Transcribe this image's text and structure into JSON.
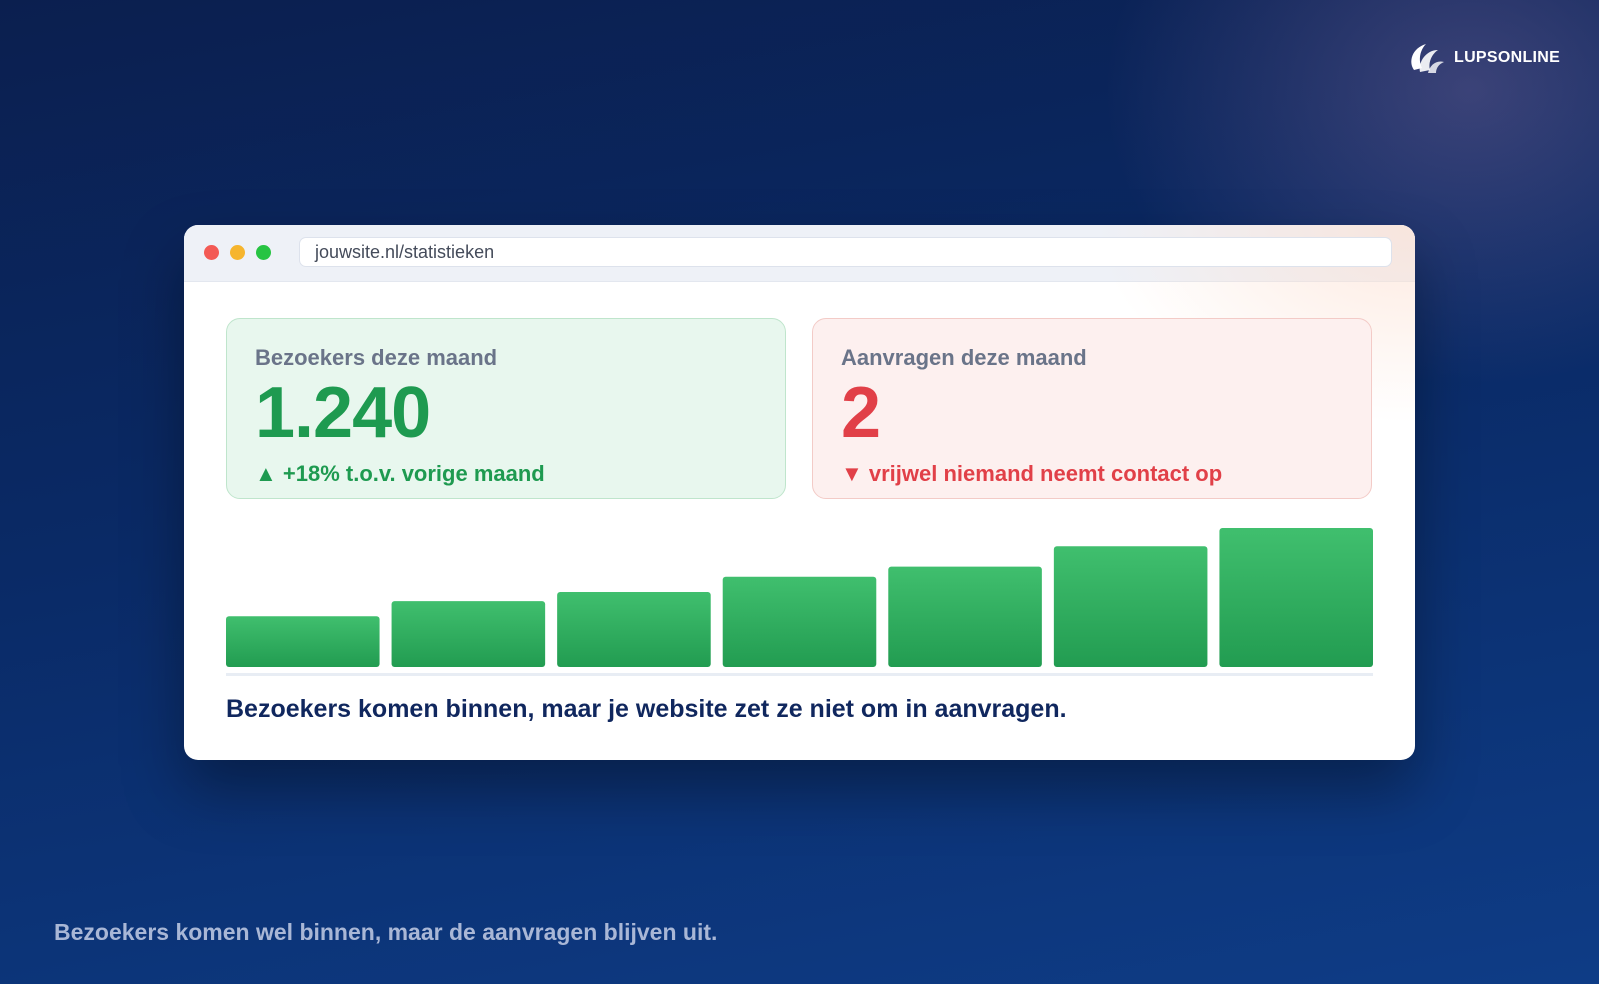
{
  "brand": {
    "logo_text": "LUPSONLINE",
    "logo_icon": "lupsonline-logo-icon"
  },
  "browser": {
    "url": "jouwsite.nl/statistieken",
    "controls": [
      "close-dot",
      "minimize-dot",
      "maximize-dot"
    ]
  },
  "cards": {
    "visitors": {
      "label": "Bezoekers deze maand",
      "value": "1.240",
      "note": "▲ +18% t.o.v. vorige maand",
      "color": "#1e9a50"
    },
    "requests": {
      "label": "Aanvragen deze maand",
      "value": "2",
      "note": "▼ vrijwel niemand neemt contact op",
      "color": "#e14048"
    }
  },
  "chart_data": {
    "type": "bar",
    "categories": [
      "",
      "",
      "",
      "",
      "",
      "",
      ""
    ],
    "values": [
      50,
      65,
      74,
      89,
      99,
      119,
      137
    ],
    "ylim": [
      0,
      140
    ],
    "title": "",
    "xlabel": "",
    "ylabel": "",
    "grid": false,
    "bar_color_top": "#40bf6e",
    "bar_color_bottom": "#229c51"
  },
  "caption": "Bezoekers komen binnen, maar je website zet ze niet om in aanvragen.",
  "footer": "Bezoekers komen wel binnen, maar de aanvragen blijven uit."
}
